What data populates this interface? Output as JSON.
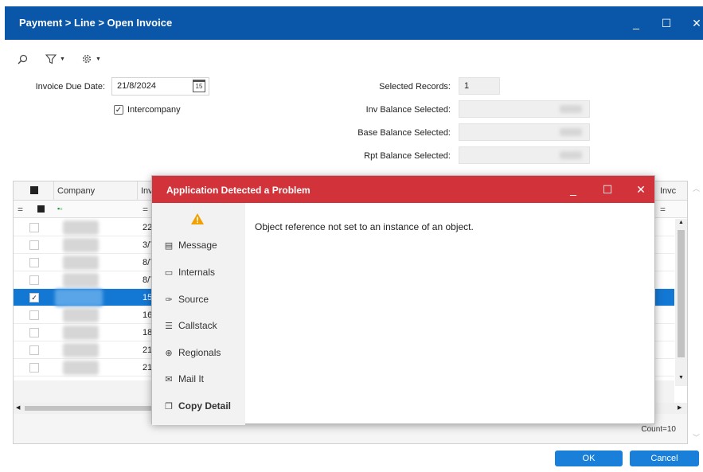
{
  "window": {
    "title": "Payment > Line > Open Invoice",
    "minimize_glyph": "_",
    "maximize_glyph": "☐",
    "close_glyph": "✕"
  },
  "toolbar": {
    "icons": [
      "search-icon",
      "filter-icon",
      "settings-icon"
    ]
  },
  "form": {
    "due_date_label": "Invoice Due Date:",
    "due_date_value": "21/8/2024",
    "calendar_badge": "15",
    "intercompany_label": "Intercompany",
    "intercompany_checked": true,
    "selected_records_label": "Selected Records:",
    "selected_records_value": "1",
    "inv_balance_label": "Inv Balance Selected:",
    "base_balance_label": "Base Balance Selected:",
    "rpt_balance_label": "Rpt Balance Selected:"
  },
  "grid": {
    "columns": [
      "Company",
      "Inv",
      "Invc"
    ],
    "filter_eq": "=",
    "rows": [
      {
        "inv": "22,",
        "selected": false
      },
      {
        "inv": "3/7",
        "selected": false
      },
      {
        "inv": "8/7",
        "selected": false
      },
      {
        "inv": "8/7",
        "selected": false
      },
      {
        "inv": "15,",
        "selected": true
      },
      {
        "inv": "16,",
        "selected": false
      },
      {
        "inv": "18,",
        "selected": false
      },
      {
        "inv": "21,",
        "selected": false
      },
      {
        "inv": "21,",
        "selected": false
      }
    ],
    "count_text": "Count=10"
  },
  "dialog": {
    "title": "Application Detected a Problem",
    "message": "Object reference not set to an instance of an object.",
    "side_items": [
      {
        "label": "Message",
        "icon": "message-icon"
      },
      {
        "label": "Internals",
        "icon": "chat-icon"
      },
      {
        "label": "Source",
        "icon": "pin-icon"
      },
      {
        "label": "Callstack",
        "icon": "list-icon"
      },
      {
        "label": "Regionals",
        "icon": "globe-icon"
      },
      {
        "label": "Mail It",
        "icon": "mail-icon"
      },
      {
        "label": "Copy Detail",
        "icon": "copy-icon"
      }
    ]
  },
  "buttons": {
    "ok": "OK",
    "cancel": "Cancel"
  },
  "colors": {
    "titlebar": "#0a56a8",
    "dialog_title": "#d2333a",
    "selection": "#1378d4",
    "button": "#1a7fd8",
    "warning": "#f0a000"
  }
}
